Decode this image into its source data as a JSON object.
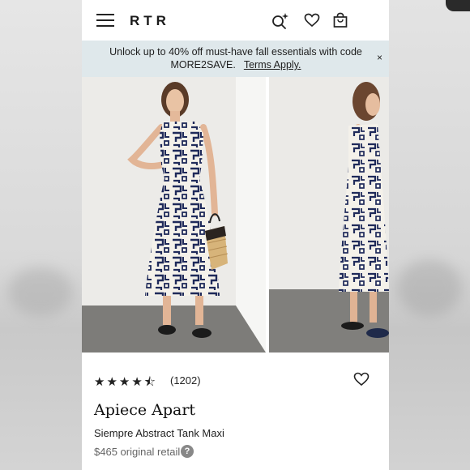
{
  "header": {
    "logo": "RTR",
    "icons": [
      "menu-icon",
      "search-sparkle-icon",
      "heart-icon",
      "bag-icon"
    ]
  },
  "promo": {
    "text": "Unlock up to 40% off must-have fall essentials with code MORE2SAVE.",
    "link": "Terms Apply.",
    "close": "×",
    "background": "#dfe8eb"
  },
  "gallery": {
    "images": [
      "front-view-photo",
      "side-view-photo"
    ],
    "dress_colors": [
      "#f4f1ea",
      "#1f2a5a"
    ]
  },
  "product": {
    "rating_stars": "★★★★⯪",
    "rating_value": 4.5,
    "review_count": "(1202)",
    "brand": "Apiece Apart",
    "name": "Siempre Abstract Tank Maxi",
    "price_text": "$465 original retail",
    "help": "?"
  }
}
